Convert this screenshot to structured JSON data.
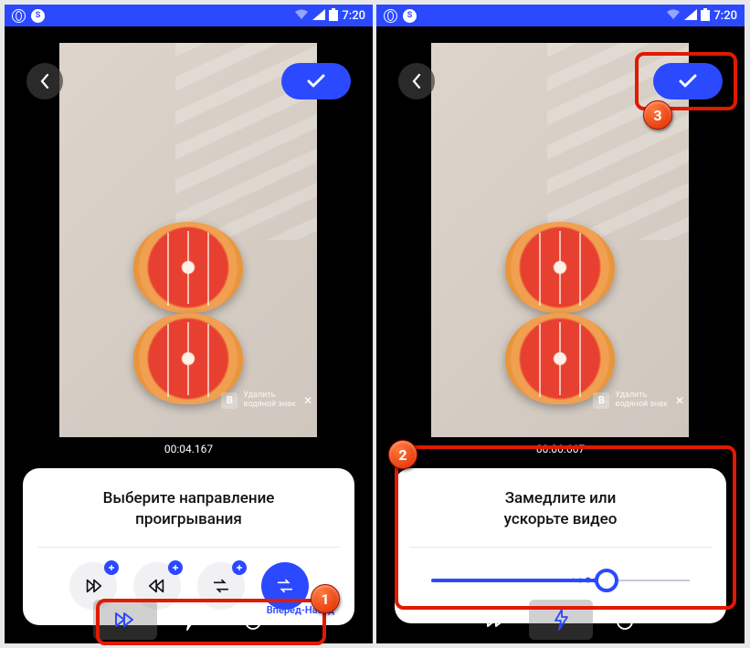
{
  "statusbar": {
    "time": "7:20"
  },
  "left": {
    "timestamp": "00:04.167",
    "watermark": {
      "label": "Удалить\nводяной знак"
    },
    "card": {
      "title_line1": "Выберите направление",
      "title_line2": "проигрывания",
      "active_label": "Вперед-Назад",
      "options": [
        {
          "name": "forward"
        },
        {
          "name": "backward"
        },
        {
          "name": "pingpong-a"
        },
        {
          "name": "pingpong-b"
        }
      ]
    },
    "tabs": {
      "active": "speed-forward"
    }
  },
  "right": {
    "timestamp": "00:06.667",
    "watermark": {
      "label": "Удалить\nводяной знак"
    },
    "card": {
      "title_line1": "Замедлите или",
      "title_line2": "ускорьте видео"
    },
    "tabs": {
      "active": "speed-flash"
    }
  },
  "annotations": {
    "n1": "1",
    "n2": "2",
    "n3": "3"
  }
}
